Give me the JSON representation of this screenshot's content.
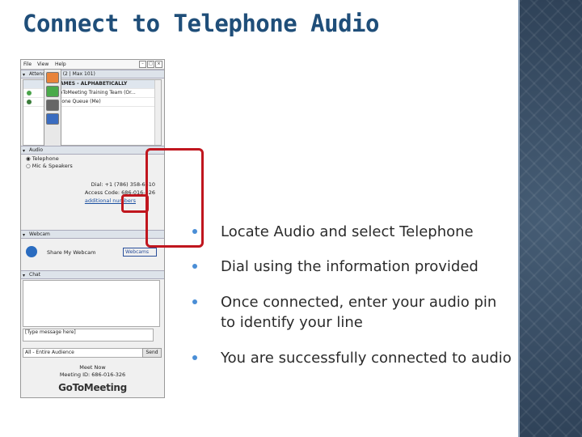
{
  "title": "Connect to Telephone Audio",
  "bullets": [
    "Locate Audio and select Telephone",
    "Dial using the information provided",
    "Once connected, enter your audio pin to identify your line",
    "You are successfully connected to audio"
  ],
  "screenshot": {
    "menu": [
      "File",
      "View",
      "Help"
    ],
    "attendee_header": "Attendee List (2 | Max 101)",
    "attendee_col": "NAMES - ALPHABETICALLY",
    "attendees": [
      "GoToMeeting Training Team (Or...",
      "Phone Queue (Me)"
    ],
    "audio_section": "Audio",
    "audio_options": [
      "Telephone",
      "Mic & Speakers"
    ],
    "dial": "Dial: +1 (786) 358-6410",
    "access_code": "Access Code: 686-016-326",
    "additional_numbers": "additional numbers",
    "webcam_section": "Webcam",
    "share_webcam": "Share My Webcam",
    "webcams_select": "Webcams",
    "chat_section": "Chat",
    "chat_placeholder": "[Type message here]",
    "chat_to": "All - Entire Audience",
    "send": "Send",
    "meeting_name": "Meet Now",
    "meeting_id": "Meeting ID: 686-016-326",
    "logo": "GoToMeeting"
  },
  "colors": {
    "title": "#1f4e79",
    "highlight": "#c0161e",
    "bullet": "#4a8ed6",
    "side_strip": "#3a5068"
  }
}
